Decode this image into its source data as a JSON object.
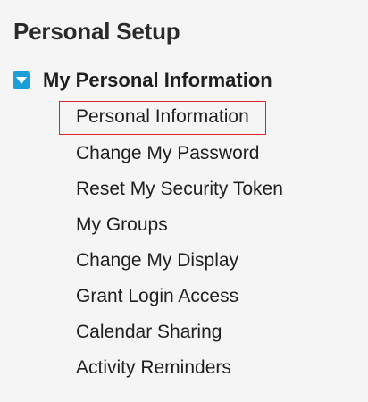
{
  "panel": {
    "title": "Personal Setup"
  },
  "section": {
    "label": "My Personal Information",
    "icon": "expand-toggle-icon",
    "expanded": true,
    "accent_color": "#1c9fd4"
  },
  "menu": {
    "selected_index": 0,
    "selected_border_color": "#d9252b",
    "items": [
      {
        "label": "Personal Information"
      },
      {
        "label": "Change My Password"
      },
      {
        "label": "Reset My Security Token"
      },
      {
        "label": "My Groups"
      },
      {
        "label": "Change My Display"
      },
      {
        "label": "Grant Login Access"
      },
      {
        "label": "Calendar Sharing"
      },
      {
        "label": "Activity Reminders"
      }
    ]
  }
}
